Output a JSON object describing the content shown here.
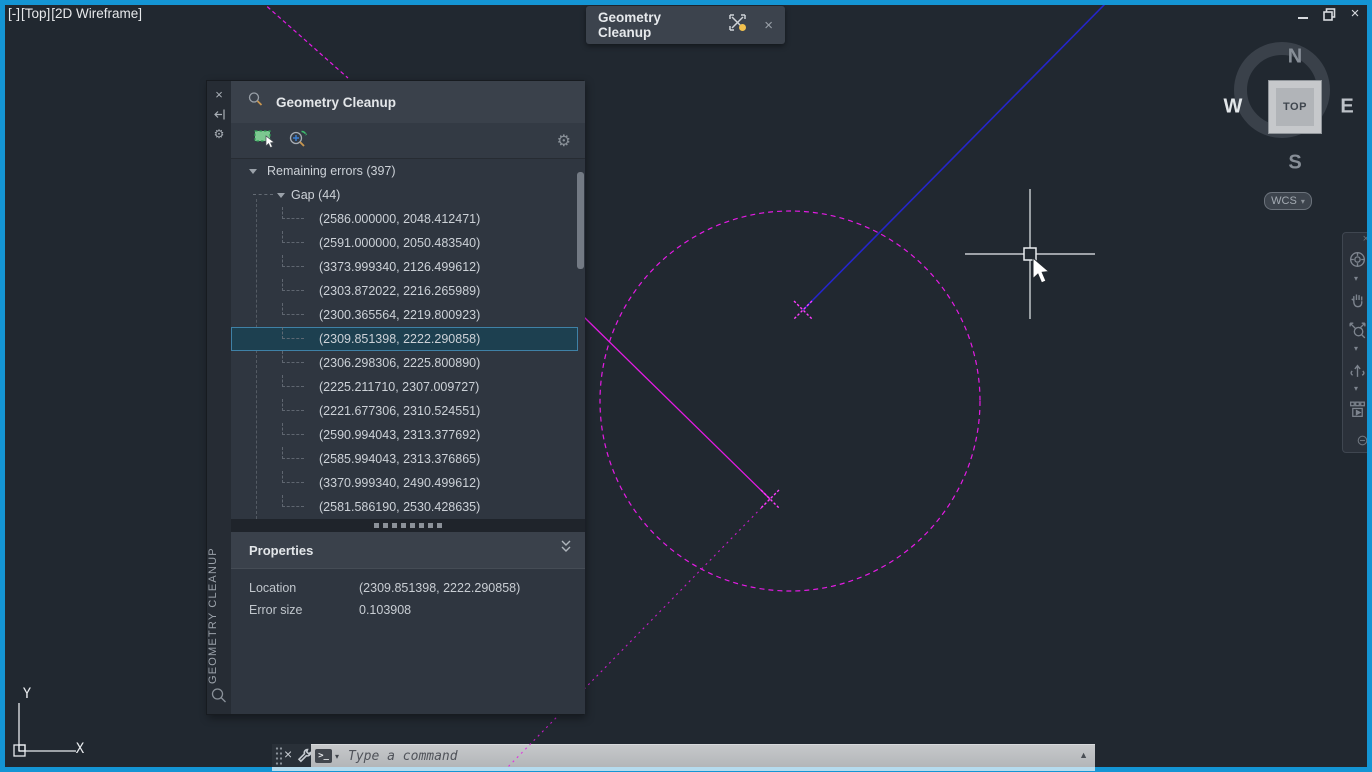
{
  "viewport_controls": {
    "expand": "[-]",
    "view": "[Top]",
    "visual_style": "[2D Wireframe]"
  },
  "icons": {
    "close_glyph": "×",
    "caret_down": "▾",
    "caret_up": "▲",
    "gear_glyph": "⚙"
  },
  "float_tab": {
    "title": "Geometry Cleanup"
  },
  "palette": {
    "title": "Geometry Cleanup",
    "side_label": "GEOMETRY CLEANUP",
    "tree": {
      "root_label": "Remaining errors (397)",
      "group_label": "Gap (44)",
      "selected_index": 5,
      "items": [
        "(2586.000000, 2048.412471)",
        "(2591.000000, 2050.483540)",
        "(3373.999340, 2126.499612)",
        "(2303.872022, 2216.265989)",
        "(2300.365564, 2219.800923)",
        "(2309.851398, 2222.290858)",
        "(2306.298306, 2225.800890)",
        "(2225.211710, 2307.009727)",
        "(2221.677306, 2310.524551)",
        "(2590.994043, 2313.377692)",
        "(2585.994043, 2313.376865)",
        "(3370.999340, 2490.499612)",
        "(2581.586190, 2530.428635)"
      ]
    },
    "properties_title": "Properties",
    "properties_rows": [
      {
        "label": "Location",
        "value": "(2309.851398, 2222.290858)"
      },
      {
        "label": "Error size",
        "value": "0.103908"
      }
    ]
  },
  "viewcube": {
    "n": "N",
    "s": "S",
    "e": "E",
    "w": "W",
    "face": "TOP",
    "wcs_label": "WCS"
  },
  "command_bar": {
    "placeholder": "Type a command"
  },
  "ucs_axes": {
    "x": "X",
    "y": "Y"
  },
  "colors": {
    "frame_border": "#1495d4",
    "magenta": "#e41be4",
    "blue_line": "#2525cc",
    "selection_bg": "#1d4050",
    "selection_border": "#3f81a6"
  }
}
